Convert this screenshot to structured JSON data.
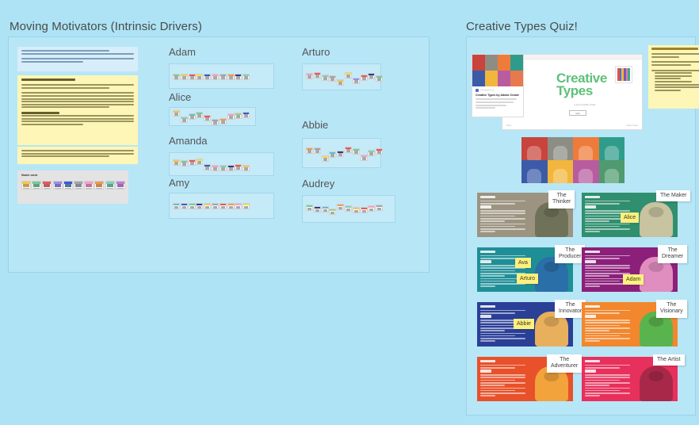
{
  "board": {
    "background_color": "#ade3f5"
  },
  "moving_motivators": {
    "title": "Moving Motivators (Intrinsic Drivers)",
    "intro_note": {
      "line1_pre": "Moving Motivators is an exercise meant to help us reflect on ",
      "link1": "motivation",
      "line1_mid": " and how it affects ",
      "link2": "organizational change",
      "line1_post": ". From Management 3.0 invented by Jurgen Appelo.",
      "line2": "The Moving Motivators exercise is based on ten intrinsic desires, derived from the works of Daniel Pink, Steven Reiss, and Edward Deci."
    },
    "howto_note": {
      "heading": "How to play Moving Motivators:",
      "step_one": "Step One: Define which motivators are important to you. Place the cards in order from left (most important) to right (least important.)",
      "step_two": "Step Two: Time for reflection and discussion. Talk to your teammates about which motivators are least and most important to them. This will give you better insight into what drives your colleagues and allow you to create stronger relationships and increase collaboration. Use it also as a tool to reflect and assess your own life decisions. Where most of your important motivators go down or where the least important ones go up it might be time for reflection.",
      "checkin_heading": "TEAM CHECK IN:",
      "checkin_body": "Use HEIGHTS for the cards. Set up a Scale where the HIGHER the card, the more the motivation is being met. The lower means it's not being met. Pay attention to any TOP 4 needs that are very low and explore whether anything can be done to meet this need as a team."
    },
    "footnote": "Note: sometimes cards are low due to organizational factors (i.e. high uncertainty, lots of change, etc. that the team can't control. But what in within your realm of control? Maybe shift some work responsibilities? Find another way to meet this need as a team.",
    "master_cards_label": "Master cards",
    "master_cards": [
      {
        "name": "Curiosity",
        "top": "#f2c94c",
        "art": "#b0791f"
      },
      {
        "name": "Honor",
        "top": "#6fcf97",
        "art": "#2f7d53"
      },
      {
        "name": "Acceptance",
        "top": "#eb5757",
        "art": "#9c2a2a"
      },
      {
        "name": "Mastery",
        "top": "#9b8cf0",
        "art": "#4b3da0"
      },
      {
        "name": "Power",
        "top": "#2f5fd0",
        "art": "#21407f"
      },
      {
        "name": "Freedom",
        "top": "#9ea5ad",
        "art": "#5b6168"
      },
      {
        "name": "Relatedness",
        "top": "#f2a0c8",
        "art": "#a8447c"
      },
      {
        "name": "Order",
        "top": "#f2994a",
        "art": "#a2622a"
      },
      {
        "name": "Goal",
        "top": "#7fd1b9",
        "art": "#2f7f6a"
      },
      {
        "name": "Status",
        "top": "#c47ad6",
        "art": "#7a3a8c"
      }
    ],
    "people": [
      {
        "name": "Adam",
        "cards": [
          {
            "top": "#6fcf97",
            "offset": 0
          },
          {
            "top": "#f2c94c",
            "offset": 0
          },
          {
            "top": "#eb5757",
            "offset": 0
          },
          {
            "top": "#f2e14c",
            "offset": 0
          },
          {
            "top": "#2f5fd0",
            "offset": 0
          },
          {
            "top": "#f2a0c8",
            "offset": 0
          },
          {
            "top": "#9ea5ad",
            "offset": 0
          },
          {
            "top": "#f2994a",
            "offset": 0
          },
          {
            "top": "#2f3d8c",
            "offset": 0
          },
          {
            "top": "#7fd1b9",
            "offset": 0
          }
        ]
      },
      {
        "name": "Alice",
        "cards": [
          {
            "top": "#f2c94c",
            "offset": -5
          },
          {
            "top": "#7fd1b9",
            "offset": 3
          },
          {
            "top": "#56c2d6",
            "offset": -1
          },
          {
            "top": "#6fcf97",
            "offset": -3
          },
          {
            "top": "#eb5757",
            "offset": 1
          },
          {
            "top": "#9ea5ad",
            "offset": 6
          },
          {
            "top": "#f2994a",
            "offset": 5
          },
          {
            "top": "#f2a0c8",
            "offset": -1
          },
          {
            "top": "#9bd47f",
            "offset": -2
          },
          {
            "top": "#2f5fd0",
            "offset": -3
          }
        ]
      },
      {
        "name": "Amanda",
        "cards": [
          {
            "top": "#f2c94c",
            "offset": -3
          },
          {
            "top": "#6fcf97",
            "offset": -2
          },
          {
            "top": "#eb5757",
            "offset": -3
          },
          {
            "top": "#f2e14c",
            "offset": -4
          },
          {
            "top": "#2f5fd0",
            "offset": 3
          },
          {
            "top": "#f2a0c8",
            "offset": 4
          },
          {
            "top": "#7fd1b9",
            "offset": 4
          },
          {
            "top": "#2f3d8c",
            "offset": 4
          },
          {
            "top": "#eb5757",
            "offset": 3
          },
          {
            "top": "#f2c94c",
            "offset": 4
          }
        ]
      },
      {
        "name": "Amy",
        "cards": [
          {
            "top": "#56c2d6",
            "offset": 0
          },
          {
            "top": "#2f5fd0",
            "offset": 0
          },
          {
            "top": "#6fcf97",
            "offset": 0
          },
          {
            "top": "#2f3d8c",
            "offset": 0
          },
          {
            "top": "#f2c94c",
            "offset": 0
          },
          {
            "top": "#9ea5ad",
            "offset": 0
          },
          {
            "top": "#eb5757",
            "offset": 0
          },
          {
            "top": "#f2994a",
            "offset": 0
          },
          {
            "top": "#f2a0c8",
            "offset": 0
          },
          {
            "top": "#f2e14c",
            "offset": 0
          }
        ]
      },
      {
        "name": "Arturo",
        "cards": [
          {
            "top": "#f2a0c8",
            "offset": -2
          },
          {
            "top": "#eb5757",
            "offset": -3
          },
          {
            "top": "#7fd1b9",
            "offset": 0
          },
          {
            "top": "#9ea5ad",
            "offset": 1
          },
          {
            "top": "#f2c94c",
            "offset": 6
          },
          {
            "top": "#f2e14c",
            "offset": -3
          },
          {
            "top": "#9b8cf0",
            "offset": 4
          },
          {
            "top": "#eb5757",
            "offset": 0
          },
          {
            "top": "#2f3d8c",
            "offset": -2
          },
          {
            "top": "#6fcf97",
            "offset": 1
          }
        ]
      },
      {
        "name": "Abbie",
        "cards": [
          {
            "top": "#f2994a",
            "offset": -4
          },
          {
            "top": "#9ea5ad",
            "offset": -4
          },
          {
            "top": "#f2e14c",
            "offset": 6
          },
          {
            "top": "#56c2d6",
            "offset": 1
          },
          {
            "top": "#2f3d8c",
            "offset": 0
          },
          {
            "top": "#eb5757",
            "offset": -5
          },
          {
            "top": "#6fcf97",
            "offset": -3
          },
          {
            "top": "#f2a0c8",
            "offset": 5
          },
          {
            "top": "#7fd1b9",
            "offset": -1
          },
          {
            "top": "#eb5757",
            "offset": -3
          }
        ]
      },
      {
        "name": "Audrey",
        "cards": [
          {
            "top": "#6fcf97",
            "offset": -2
          },
          {
            "top": "#2f3d8c",
            "offset": 0
          },
          {
            "top": "#56c2d6",
            "offset": 0
          },
          {
            "top": "#9bd47f",
            "offset": 3
          },
          {
            "top": "#f2994a",
            "offset": -3
          },
          {
            "top": "#7fd1b9",
            "offset": -1
          },
          {
            "top": "#f2c94c",
            "offset": 1
          },
          {
            "top": "#eb5757",
            "offset": 1
          },
          {
            "top": "#f2a0c8",
            "offset": -1
          },
          {
            "top": "#9ea5ad",
            "offset": -2
          }
        ]
      }
    ]
  },
  "creative_types": {
    "title": "Creative Types Quiz!",
    "hero": {
      "title_line1": "Creative",
      "title_line2": "Types",
      "subtitle": "a quiz by Adobe Create",
      "button_label": "Start",
      "foot_left": "Share",
      "foot_right": "Adobe Create",
      "swatch_colors": [
        "#e0524a",
        "#4a6fd4",
        "#f2b63c",
        "#7b57b5",
        "#e27fa8",
        "#3fa88a"
      ]
    },
    "promo_card": {
      "source": "creativetypes.com",
      "headline": "Creative Types by Adobe Create",
      "body": "Everyone has a creative \"type\". Knowing yours helps you maximize your potential. Take the quiz to discover your type!",
      "tile_colors": [
        "#c8443c",
        "#8d8d84",
        "#ef7b3a",
        "#2f9c8b",
        "#3b5ba8",
        "#f2b63c",
        "#b85ca0",
        "#e8794f"
      ]
    },
    "howto_note": {
      "heading": "How to use Adobe Creative Types:",
      "step_one": "Step One: Give everyone the link and have them take the quiz. It takes about 5 minutes :)",
      "step_two": "Step Two: Ask team members to put their sticky note on their creative type card.",
      "step_three": "Step Three: There are 8 types, so a few discussion questions to ask:",
      "bullets": [
        "What is a good type to be paired with?",
        "What do you like about your type?",
        "Do you think it's accurate?",
        "What might this mean for our team dynamics?",
        "Do we have any gaps on the team? i.e. we don't have an Maker or Producer. If not, what kind of structure do you need to be successful?"
      ]
    },
    "persona_strip_colors": [
      "#c8443c",
      "#8d8d84",
      "#ef7b3a",
      "#2f9c8b",
      "#3b5ba8",
      "#f2b63c",
      "#b85ca0",
      "#4f9b6f"
    ],
    "type_cards": [
      {
        "label": "The\nThinker",
        "bg": "#9c9480",
        "figure": "#6f7258",
        "accent": "#ffffff",
        "notes": []
      },
      {
        "label": "The Maker",
        "bg": "#2f8f6e",
        "figure": "#c8c3a0",
        "accent": "#ffffff",
        "notes": [
          "Alice"
        ]
      },
      {
        "label": "The\nProducer",
        "bg": "#1f8f97",
        "figure": "#2b6fa8",
        "accent": "#ffffff",
        "notes": [
          "Ava",
          "Arturo"
        ]
      },
      {
        "label": "The\nDreamer",
        "bg": "#8c1f7a",
        "figure": "#e08ec0",
        "accent": "#ffffff",
        "notes": [
          "Adam"
        ]
      },
      {
        "label": "The\nInnovator",
        "bg": "#2a3f96",
        "figure": "#e8b05c",
        "accent": "#ffffff",
        "notes": [
          "Abbie"
        ]
      },
      {
        "label": "The\nVisionary",
        "bg": "#f2872e",
        "figure": "#5ab44e",
        "accent": "#ffffff",
        "notes": []
      },
      {
        "label": "The\nAdventurer",
        "bg": "#e8512a",
        "figure": "#f2a33c",
        "accent": "#ffffff",
        "notes": []
      },
      {
        "label": "The Artist",
        "bg": "#e8305c",
        "figure": "#a8284a",
        "accent": "#ffffff",
        "notes": []
      }
    ]
  }
}
